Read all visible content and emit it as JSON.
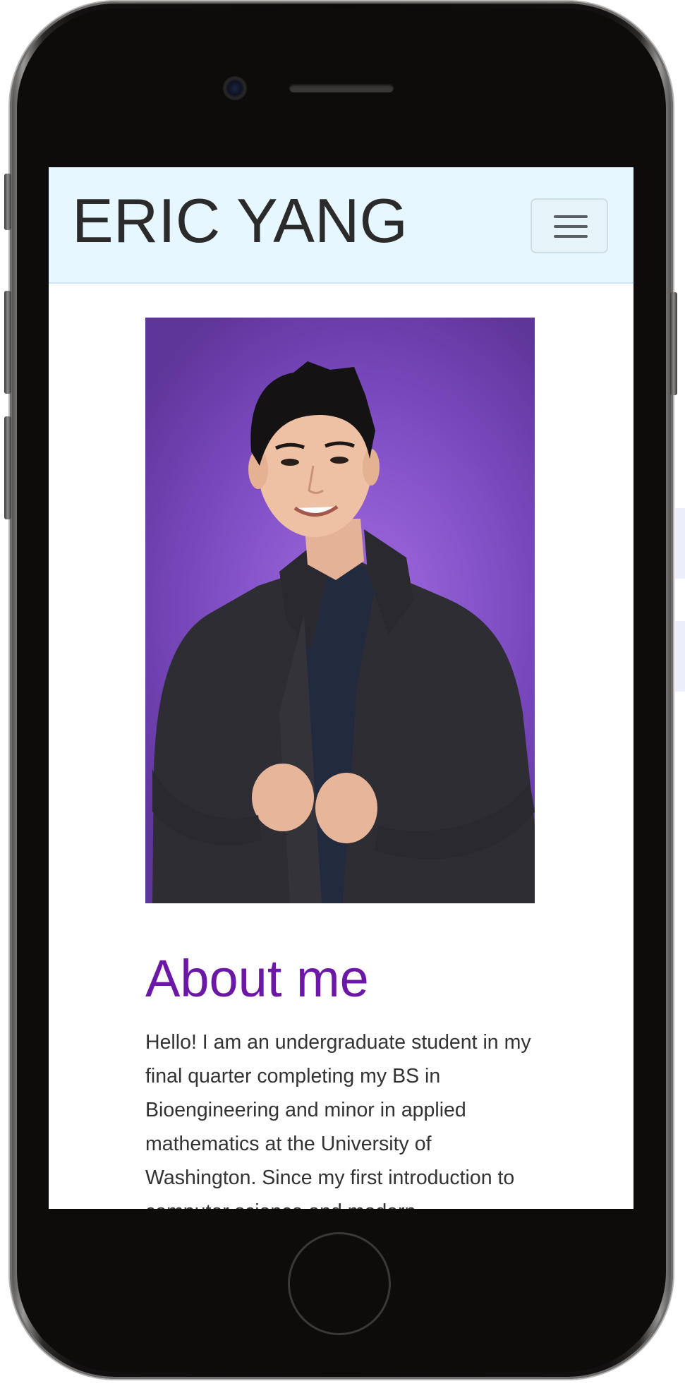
{
  "site": {
    "brand": "ERIC YANG"
  },
  "navbar": {
    "toggle_icon": "hamburger-icon"
  },
  "profile_photo": {
    "icon": "portrait-photo"
  },
  "about": {
    "heading": "About me",
    "text": "Hello! I am an undergraduate student in my final quarter completing my BS in Bioengineering and minor in applied mathematics at the University of Washington. Since my first introduction to computer science and modern"
  },
  "colors": {
    "navbar_bg": "#e6f7ff",
    "heading": "#6c17a6",
    "photo_bg": "#8553c9",
    "body_text": "#333333"
  }
}
